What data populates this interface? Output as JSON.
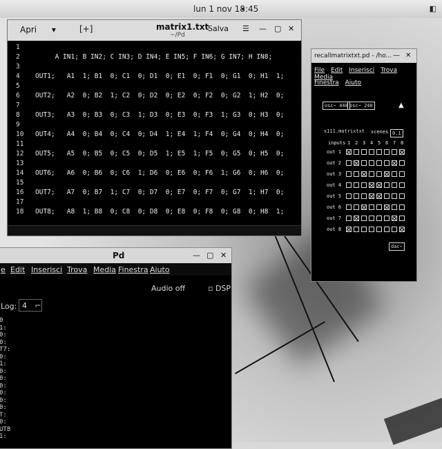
{
  "topbar": {
    "clock": "lun 1 nov 18:45"
  },
  "gedit": {
    "open_label": "Apri",
    "newtab_icon": "new-tab-icon",
    "title": "matrix1.txt",
    "subtitle": "~/Pd",
    "save_label": "Salva",
    "lines": [
      {
        "n": "1",
        "t": ""
      },
      {
        "n": "2",
        "t": "     A IN1; B IN2; C IN3; D IN4; E IN5; F IN6; G IN7; H IN8;"
      },
      {
        "n": "3",
        "t": ""
      },
      {
        "n": "4",
        "t": "OUT1;   A1  1; B1  0; C1  0; D1  0; E1  0; F1  0; G1  0; H1  1;"
      },
      {
        "n": "5",
        "t": ""
      },
      {
        "n": "6",
        "t": "OUT2;   A2  0; B2  1; C2  0; D2  0; E2  0; F2  0; G2  1; H2  0;"
      },
      {
        "n": "7",
        "t": ""
      },
      {
        "n": "8",
        "t": "OUT3;   A3  0; B3  0; C3  1; D3  0; E3  0; F3  1; G3  0; H3  0;"
      },
      {
        "n": "9",
        "t": ""
      },
      {
        "n": "10",
        "t": "OUT4;   A4  0; B4  0; C4  0; D4  1; E4  1; F4  0; G4  0; H4  0;"
      },
      {
        "n": "11",
        "t": ""
      },
      {
        "n": "12",
        "t": "OUT5;   A5  0; B5  0; C5  0; D5  1; E5  1; F5  0; G5  0; H5  0;"
      },
      {
        "n": "13",
        "t": ""
      },
      {
        "n": "14",
        "t": "OUT6;   A6  0; B6  0; C6  1; D6  0; E6  0; F6  1; G6  0; H6  0;"
      },
      {
        "n": "15",
        "t": ""
      },
      {
        "n": "16",
        "t": "OUT7;   A7  0; B7  1; C7  0; D7  0; E7  0; F7  0; G7  1; H7  0;"
      },
      {
        "n": "17",
        "t": ""
      },
      {
        "n": "18",
        "t": "OUT8;   A8  1; B8  0; C8  0; D8  0; E8  0; F8  0; G8  0; H8  1;"
      }
    ]
  },
  "patch": {
    "title": "recallmatrixtxt.pd - /ho...",
    "menu": [
      "File",
      "Edit",
      "Inserisci",
      "Trova",
      "Media"
    ],
    "menu2": [
      "Finestra",
      "Aiuto"
    ],
    "osc1": "osc~ 440",
    "osc2": "osc~ 240",
    "matrix_obj": "s111.matrixtxt",
    "scenes_label": "scenes",
    "scenes_val": "0.1",
    "inputs_label": "inputs",
    "cols": [
      "1",
      "2",
      "3",
      "4",
      "5",
      "6",
      "7",
      "8"
    ],
    "rows": [
      "out 1",
      "out 2",
      "out 3",
      "out 4",
      "out 5",
      "out 6",
      "out 7",
      "out 8"
    ],
    "matrix": [
      [
        1,
        0,
        0,
        0,
        0,
        0,
        0,
        1
      ],
      [
        0,
        1,
        0,
        0,
        0,
        0,
        1,
        0
      ],
      [
        0,
        0,
        1,
        0,
        0,
        1,
        0,
        0
      ],
      [
        0,
        0,
        0,
        1,
        1,
        0,
        0,
        0
      ],
      [
        0,
        0,
        0,
        1,
        1,
        0,
        0,
        0
      ],
      [
        0,
        0,
        1,
        0,
        0,
        1,
        0,
        0
      ],
      [
        0,
        1,
        0,
        0,
        0,
        0,
        1,
        0
      ],
      [
        1,
        0,
        0,
        0,
        0,
        0,
        0,
        1
      ]
    ],
    "dac": "dac~"
  },
  "pdwin": {
    "title": "Pd",
    "menu": [
      "e",
      "Edit",
      "Inserisci",
      "Trova",
      "Media",
      "Finestra",
      "Aiuto"
    ],
    "audio_status": "Audio off",
    "dsp_label": "DSP",
    "log_label": "Log:",
    "log_value": "4",
    "console": [
      "0",
      "1:",
      "0:",
      "0:",
      "T7:",
      "0:",
      "1:",
      "0:",
      "0:",
      "0:",
      "0:",
      "0:",
      "0:",
      "T:",
      "0:",
      "UT8",
      "1:"
    ]
  }
}
